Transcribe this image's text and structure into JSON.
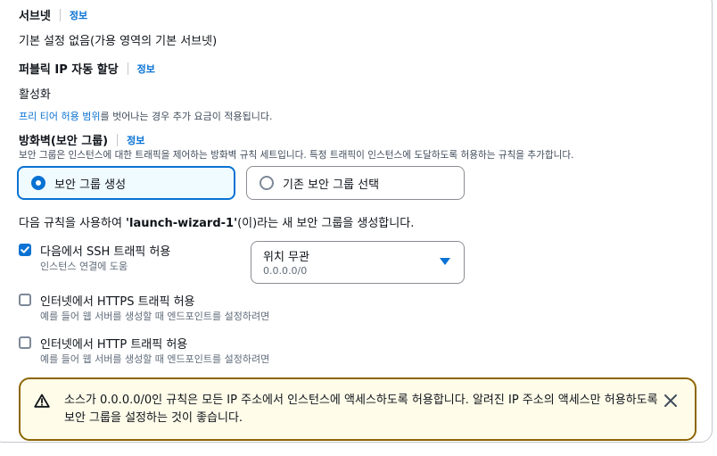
{
  "subnet": {
    "label": "서브넷",
    "info": "정보",
    "value": "기본 설정 없음(가용 영역의 기본 서브넷)"
  },
  "public_ip": {
    "label": "퍼블릭 IP 자동 할당",
    "info": "정보",
    "value": "활성화",
    "note_link": "프리 티어 허용 범위",
    "note_rest": "를 벗어나는 경우 추가 요금이 적용됩니다."
  },
  "firewall": {
    "label": "방화벽(보안 그룹)",
    "info": "정보",
    "description": "보안 그룹은 인스턴스에 대한 트래픽을 제어하는 방화벽 규칙 세트입니다. 특정 트래픽이 인스턴스에 도달하도록 허용하는 규칙을 추가합니다.",
    "options": [
      {
        "label": "보안 그룹 생성",
        "selected": true
      },
      {
        "label": "기존 보안 그룹 선택",
        "selected": false
      }
    ],
    "rule_prefix": "다음 규칙을 사용하여 ",
    "rule_name": "'launch-wizard-1'",
    "rule_suffix": "(이)라는 새 보안 그룹을 생성합니다."
  },
  "rules": [
    {
      "label": "다음에서 SSH 트래픽 허용",
      "description": "인스턴스 연결에 도움",
      "checked": true
    },
    {
      "label": "인터넷에서 HTTPS 트래픽 허용",
      "description": "예를 들어 웹 서버를 생성할 때 엔드포인트를 설정하려면",
      "checked": false
    },
    {
      "label": "인터넷에서 HTTP 트래픽 허용",
      "description": "예를 들어 웹 서버를 생성할 때 엔드포인트를 설정하려면",
      "checked": false
    }
  ],
  "ssh_source": {
    "value": "위치 무관",
    "description": "0.0.0.0/0"
  },
  "alert": {
    "text": "소스가 0.0.0.0/0인 규칙은 모든 IP 주소에서 인스턴스에 액세스하도록 허용합니다. 알려진 IP 주소의 액세스만 허용하도록 보안 그룹을 설정하는 것이 좋습니다.",
    "icon": "warning-icon",
    "close_icon": "close-icon"
  },
  "colors": {
    "accent": "#0972d3",
    "warning_border": "#8d6605",
    "warning_bg": "#fffce9"
  }
}
